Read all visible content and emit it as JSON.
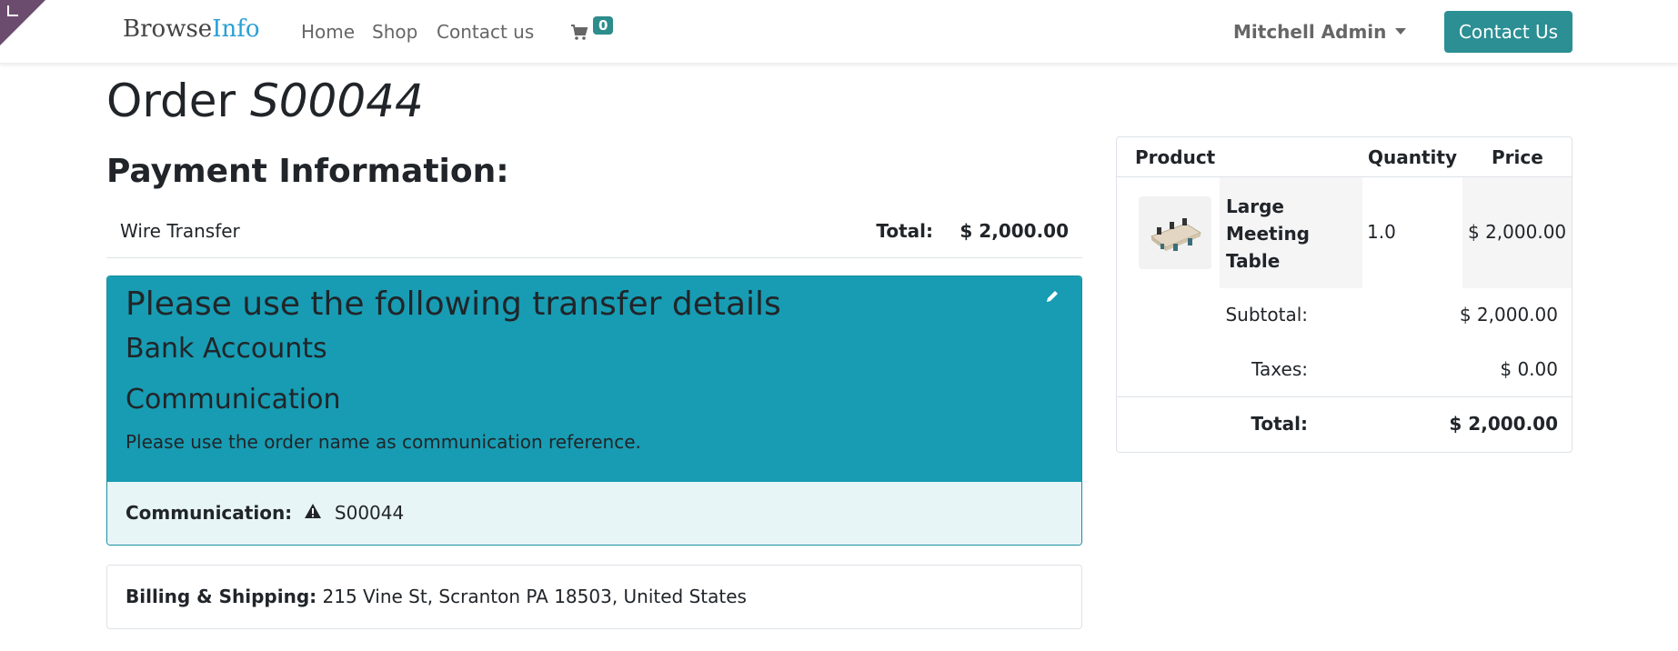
{
  "header": {
    "brand_part1": "Browse",
    "brand_part2": "Info",
    "nav": [
      "Home",
      "Shop",
      "Contact us"
    ],
    "cart_count": "0",
    "user_name": "Mitchell Admin",
    "contact_button": "Contact Us"
  },
  "order": {
    "title_prefix": "Order",
    "order_ref": "S00044"
  },
  "payment": {
    "heading": "Payment Information:",
    "method": "Wire Transfer",
    "total_label": "Total:",
    "total_value": "$ 2,000.00"
  },
  "transfer": {
    "title": "Please use the following transfer details",
    "bank_accounts": "Bank Accounts",
    "communication_heading": "Communication",
    "instruction": "Please use the order name as communication reference.",
    "communication_label": "Communication:",
    "communication_value": "S00044"
  },
  "billing": {
    "label": "Billing & Shipping:",
    "address": "215 Vine St, Scranton PA 18503, United States"
  },
  "summary": {
    "col_product": "Product",
    "col_quantity": "Quantity",
    "col_price": "Price",
    "items": [
      {
        "name": "Large Meeting Table",
        "quantity": "1.0",
        "price": "$ 2,000.00"
      }
    ],
    "subtotal_label": "Subtotal:",
    "subtotal_value": "$ 2,000.00",
    "taxes_label": "Taxes:",
    "taxes_value": "$ 0.00",
    "total_label": "Total:",
    "total_value": "$ 2,000.00"
  },
  "colors": {
    "primary": "#2b8f94",
    "info": "#179cb3",
    "info_light": "#e8f5f7",
    "brand_accent": "#2a9fd6",
    "corner": "#6b4c6e"
  },
  "icons": {
    "cart": "shopping-cart-icon",
    "edit": "pencil-icon",
    "warning": "warning-triangle-icon",
    "caret": "caret-down-icon"
  }
}
